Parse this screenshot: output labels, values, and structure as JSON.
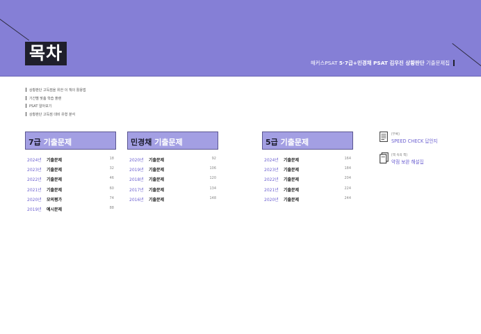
{
  "header": {
    "title": "목차",
    "subtitle_plain": "해커스PSAT ",
    "subtitle_bold": "5·7급+민경채 PSAT 김우진 상황판단",
    "subtitle_tail": " 기출문제집"
  },
  "intro_items": [
    "상황판단 고득점을 위한 이 책의 활용법",
    "기간별 맞춤 학습 플랜",
    "PSAT 알아보기",
    "상황판단 고득점 대비 유형 분석"
  ],
  "sections": [
    {
      "title_em": "7급",
      "title_rest": " 기출문제",
      "rows": [
        {
          "year": "2024년",
          "name": "기출문제",
          "page": "18"
        },
        {
          "year": "2023년",
          "name": "기출문제",
          "page": "32"
        },
        {
          "year": "2022년",
          "name": "기출문제",
          "page": "46"
        },
        {
          "year": "2021년",
          "name": "기출문제",
          "page": "60"
        },
        {
          "year": "2020년",
          "name": "모의평가",
          "page": "74"
        },
        {
          "year": "2019년",
          "name": "예시문제",
          "page": "88"
        }
      ]
    },
    {
      "title_em": "민경채",
      "title_rest": " 기출문제",
      "rows": [
        {
          "year": "2020년",
          "name": "기출문제",
          "page": "92"
        },
        {
          "year": "2019년",
          "name": "기출문제",
          "page": "106"
        },
        {
          "year": "2018년",
          "name": "기출문제",
          "page": "120"
        },
        {
          "year": "2017년",
          "name": "기출문제",
          "page": "134"
        },
        {
          "year": "2016년",
          "name": "기출문제",
          "page": "148"
        }
      ]
    },
    {
      "title_em": "5급",
      "title_rest": " 기출문제",
      "rows": [
        {
          "year": "2024년",
          "name": "기출문제",
          "page": "164"
        },
        {
          "year": "2023년",
          "name": "기출문제",
          "page": "184"
        },
        {
          "year": "2022년",
          "name": "기출문제",
          "page": "204"
        },
        {
          "year": "2021년",
          "name": "기출문제",
          "page": "224"
        },
        {
          "year": "2020년",
          "name": "기출문제",
          "page": "244"
        }
      ]
    }
  ],
  "appendix": [
    {
      "small": "[부록]",
      "main": "SPEED CHECK 답안지",
      "icon": "answer-sheet-icon"
    },
    {
      "small": "[책 속의 책]",
      "main": "약점 보완 해설집",
      "icon": "book-icon"
    }
  ]
}
